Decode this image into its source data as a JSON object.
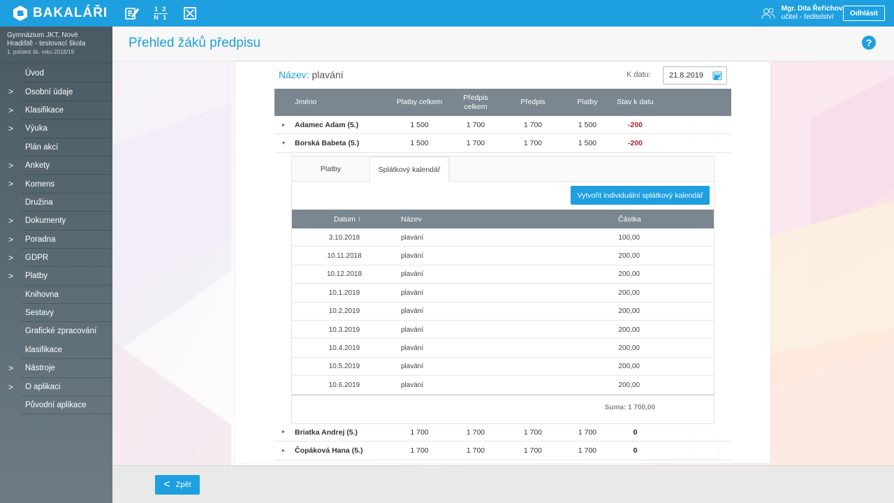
{
  "topbar": {
    "brand": "BAKALÁŘI",
    "icons": [
      "notebook-edit-icon",
      "fraction-icon",
      "x-box-icon"
    ],
    "fraction_top": "1 2",
    "fraction_bottom": "N 1",
    "user_name": "Mgr. Dita Řeřichová",
    "user_role": "učitel - ředitelství",
    "logout_label": "Odhlásit"
  },
  "sidebar": {
    "school_line1": "Gymnázium JKT, Nové",
    "school_line2": "Hradiště - testovací škola",
    "school_period": "1. pololetí šk. roku 2018/19",
    "items": [
      {
        "label": "Úvod",
        "arrow": false
      },
      {
        "label": "Osobní údaje",
        "arrow": true
      },
      {
        "label": "Klasifikace",
        "arrow": true
      },
      {
        "label": "Výuka",
        "arrow": true
      },
      {
        "label": "Plán akcí",
        "arrow": false
      },
      {
        "label": "Ankety",
        "arrow": true
      },
      {
        "label": "Komens",
        "arrow": true
      },
      {
        "label": "Družina",
        "arrow": false
      },
      {
        "label": "Dokumenty",
        "arrow": true
      },
      {
        "label": "Poradna",
        "arrow": true
      },
      {
        "label": "GDPR",
        "arrow": true
      },
      {
        "label": "Platby",
        "arrow": true
      },
      {
        "label": "Knihovna",
        "arrow": false
      },
      {
        "label": "Sestavy",
        "arrow": false
      },
      {
        "label": "Grafické zpracování",
        "label2": "klasifikace",
        "arrow": false
      },
      {
        "label": "Nástroje",
        "arrow": true
      },
      {
        "label": "O aplikaci",
        "arrow": true
      },
      {
        "label": "Původní aplikace",
        "arrow": false
      }
    ]
  },
  "page": {
    "title": "Přehled žáků předpisu",
    "help": "?",
    "back_label": "Zpět",
    "back_chevron": "<"
  },
  "card": {
    "name_label": "Název:",
    "name_value": "plavání",
    "date_label": "K datu:",
    "date_value": "21.8.2019"
  },
  "students_table": {
    "headers": {
      "name": "Jméno",
      "payments_total": "Platby celkem",
      "prescription_total": "Předpis\ncelkem",
      "prescription": "Předpis",
      "payments": "Platby",
      "state": "Stav k datu"
    },
    "rows": [
      {
        "toggle": "►",
        "name": "Adamec Adam (5.)",
        "payments_total": "1 500",
        "prescription_total": "1 700",
        "prescription": "1 700",
        "payments": "1 500",
        "state": "-200",
        "dot1": "·",
        "dot2": "·"
      },
      {
        "toggle": "▼",
        "name": "Borská Babeta (5.)",
        "payments_total": "1 500",
        "prescription_total": "1 700",
        "prescription": "1 700",
        "payments": "1 500",
        "state": "-200",
        "dot1": "·",
        "dot2": "·"
      },
      {
        "toggle": "►",
        "name": "Briatka Andrej (5.)",
        "payments_total": "1 700",
        "prescription_total": "1 700",
        "prescription": "1 700",
        "payments": "1 700",
        "state": "0",
        "dot1": "·",
        "dot2": "·"
      },
      {
        "toggle": "►",
        "name": "Čopáková Hana (5.)",
        "payments_total": "1 700",
        "prescription_total": "1 700",
        "prescription": "1 700",
        "payments": "1 700",
        "state": "0",
        "dot1": "·",
        "dot2": "·"
      }
    ]
  },
  "detail": {
    "tabs": [
      "Platby",
      "Splátkový kalendář"
    ],
    "active_tab": "Splátkový kalendář",
    "create_button": "Vytvořit individuální splátkový kalendář",
    "headers": {
      "date": "Datum ↑",
      "name": "Název",
      "amount": "Částka"
    },
    "rows": [
      {
        "date": "3.10.2018",
        "name": "plavání",
        "amount": "100,00"
      },
      {
        "date": "10.11.2018",
        "name": "plavání",
        "amount": "200,00"
      },
      {
        "date": "10.12.2018",
        "name": "plavání",
        "amount": "200,00"
      },
      {
        "date": "10.1.2019",
        "name": "plavání",
        "amount": "200,00"
      },
      {
        "date": "10.2.2019",
        "name": "plavání",
        "amount": "200,00"
      },
      {
        "date": "10.3.2019",
        "name": "plavání",
        "amount": "200,00"
      },
      {
        "date": "10.4.2019",
        "name": "plavání",
        "amount": "200,00"
      },
      {
        "date": "10.5.2019",
        "name": "plavání",
        "amount": "200,00"
      },
      {
        "date": "10.6.2019",
        "name": "plavání",
        "amount": "200,00"
      }
    ],
    "sum": "Suma: 1 700,00"
  },
  "colors": {
    "accent": "#1e9fe0",
    "sidebar": "#4a5a63",
    "table_header": "#7a8790",
    "negative": "#b4232b"
  }
}
